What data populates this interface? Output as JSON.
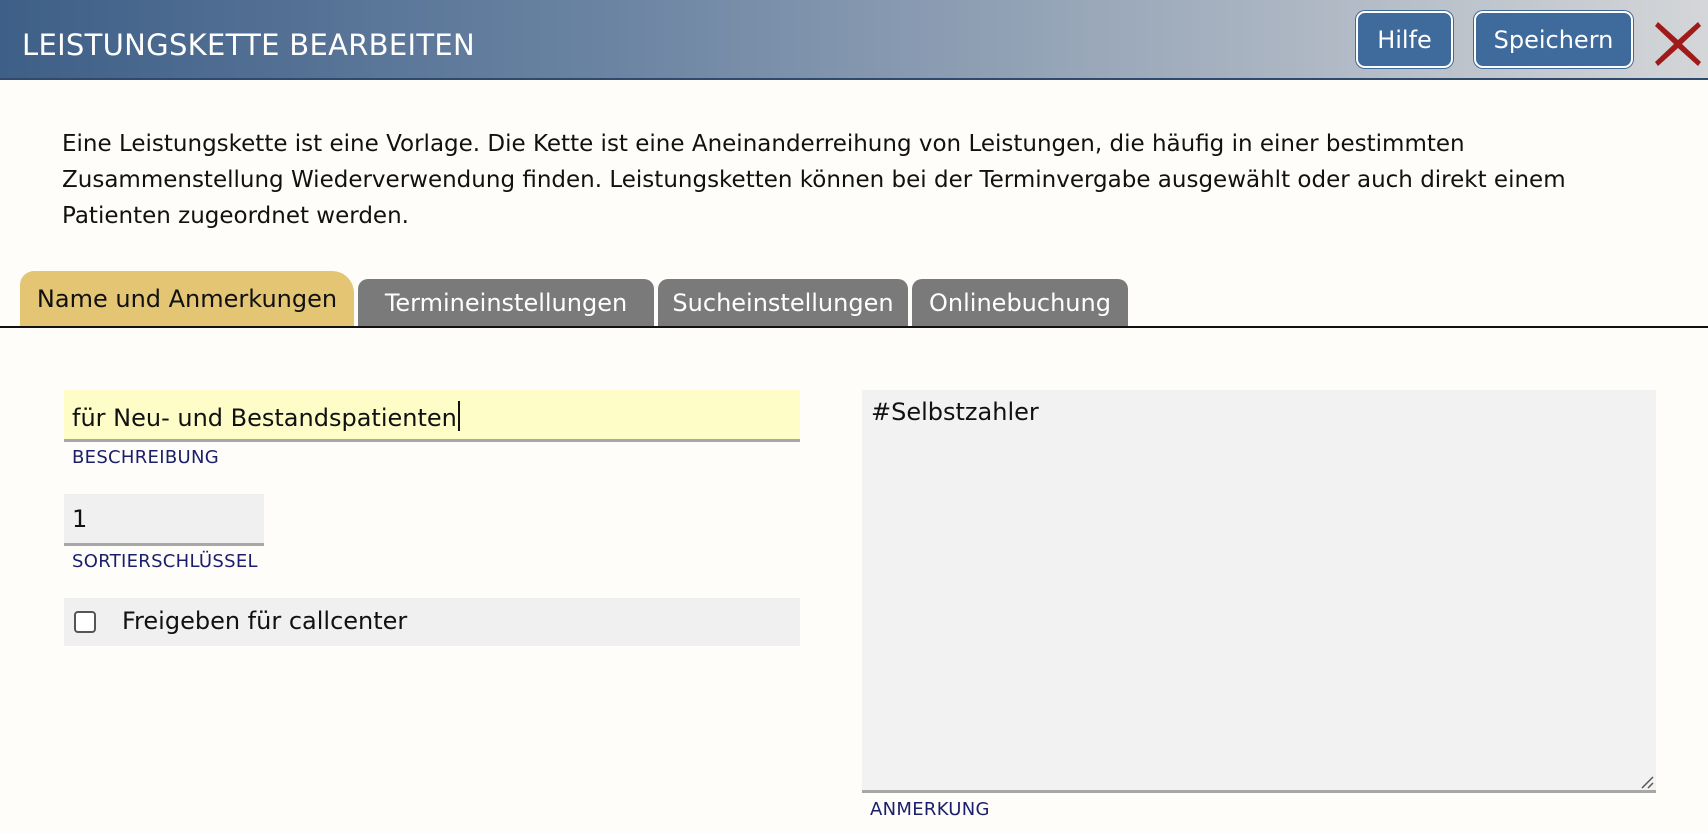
{
  "header": {
    "title": "LEISTUNGSKETTE BEARBEITEN",
    "help_label": "Hilfe",
    "save_label": "Speichern",
    "close_icon": "close-icon",
    "accent": "#3f6a9c",
    "close_color": "#a01a1a"
  },
  "intro": {
    "text": "Eine Leistungskette ist eine Vorlage. Die Kette ist eine Aneinanderreihung von Leistungen, die häufig in einer bestimmten Zusammenstellung Wiederverwendung finden. Leistungsketten können bei der Terminvergabe ausgewählt oder auch direkt einem Patienten zugeordnet werden."
  },
  "tabs": [
    {
      "label": "Name und Anmerkungen",
      "active": true
    },
    {
      "label": "Termineinstellungen",
      "active": false
    },
    {
      "label": "Sucheinstellungen",
      "active": false
    },
    {
      "label": "Onlinebuchung",
      "active": false
    }
  ],
  "form": {
    "beschreibung": {
      "value": "für Neu- und Bestandspatienten",
      "label": "BESCHREIBUNG"
    },
    "sortierschluessel": {
      "value": "1",
      "label": "SORTIERSCHLÜSSEL"
    },
    "callcenter": {
      "label": "Freigeben für callcenter",
      "checked": false
    },
    "anmerkung": {
      "value": "#Selbstzahler",
      "label": "ANMERKUNG"
    }
  }
}
